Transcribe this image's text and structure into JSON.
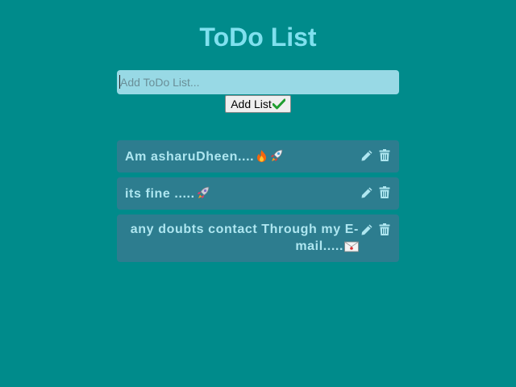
{
  "app": {
    "title": "ToDo List"
  },
  "form": {
    "placeholder": "Add ToDo List...",
    "add_button_label": "Add List",
    "add_button_icon": "check-mark-icon"
  },
  "todos": [
    {
      "text": "Am asharuDheen....",
      "emojis": [
        "fire-icon",
        "rocket-icon"
      ]
    },
    {
      "text": "its fine .....",
      "emojis": [
        "rocket-launch-icon"
      ]
    },
    {
      "text": "any doubts contact Through my E-mail.....",
      "emojis": [
        "envelope-icon"
      ]
    }
  ],
  "item_actions": {
    "edit_icon": "pencil-icon",
    "delete_icon": "trash-icon"
  },
  "colors": {
    "background": "#008b8b",
    "title": "#7fe0ee",
    "input_bg": "#98d9e5",
    "item_bg": "#2d7d8f",
    "item_text": "#aee6f0"
  }
}
